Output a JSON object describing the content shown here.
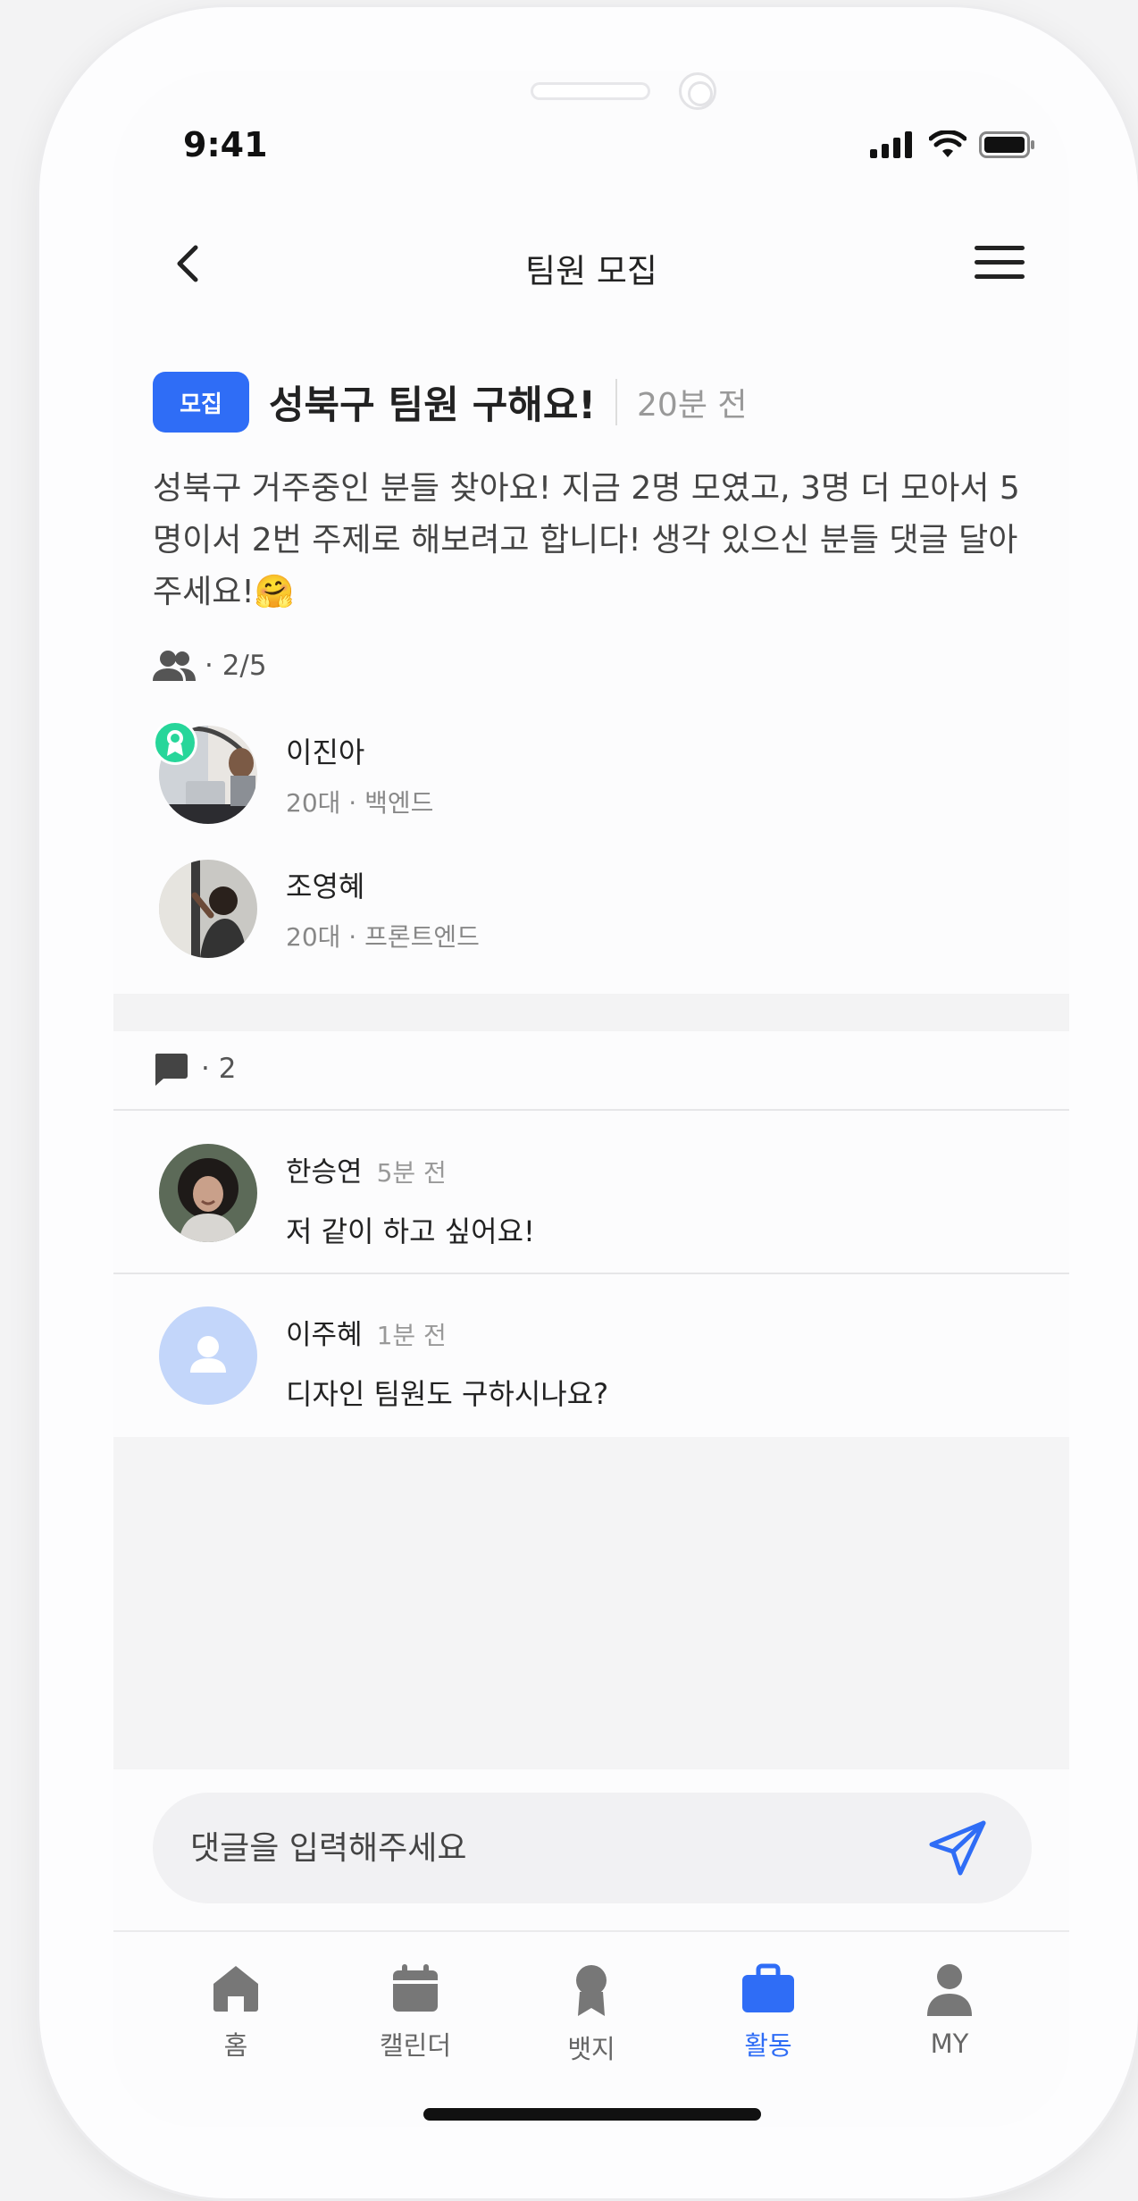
{
  "status_bar": {
    "time": "9:41"
  },
  "header": {
    "title": "팀원 모집"
  },
  "post": {
    "badge": "모집",
    "title": "성북구 팀원 구해요!",
    "time": "20분 전",
    "body": "성북구 거주중인 분들 찾아요! 지금 2명 모였고, 3명 더 모아서 5명이서 2번 주제로 해보려고 합니다! 생각 있으신 분들 댓글 달아주세요!🤗"
  },
  "members": {
    "count_label": "· 2/5",
    "items": [
      {
        "name": "이진아",
        "meta": "20대 · 백엔드",
        "leader": true
      },
      {
        "name": "조영혜",
        "meta": "20대 · 프론트엔드",
        "leader": false
      }
    ]
  },
  "comments": {
    "count_label": "· 2",
    "items": [
      {
        "name": "한승연",
        "time": "5분 전",
        "text": "저 같이 하고 싶어요!"
      },
      {
        "name": "이주혜",
        "time": "1분 전",
        "text": "디자인 팀원도 구하시나요?"
      }
    ]
  },
  "comment_input": {
    "placeholder": "댓글을 입력해주세요"
  },
  "tabbar": {
    "items": [
      {
        "label": "홈",
        "icon": "home-icon"
      },
      {
        "label": "캘린더",
        "icon": "calendar-icon"
      },
      {
        "label": "뱃지",
        "icon": "badge-icon"
      },
      {
        "label": "활동",
        "icon": "briefcase-icon"
      },
      {
        "label": "MY",
        "icon": "person-icon"
      }
    ],
    "active": "활동"
  },
  "colors": {
    "accent": "#2f6df6",
    "leader_badge": "#27d69a",
    "icon_gray": "#777777"
  }
}
